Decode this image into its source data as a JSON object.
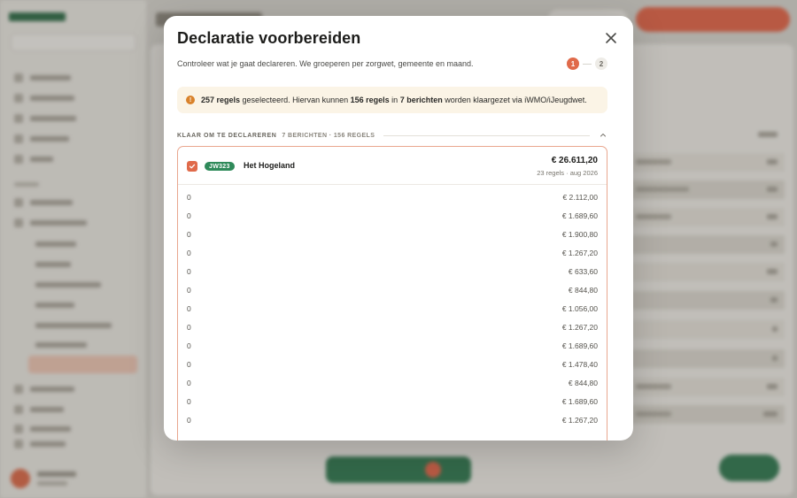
{
  "modal": {
    "title": "Declaratie voorbereiden",
    "subtitle": "Controleer wat je gaat declareren. We groeperen per zorgwet, gemeente en maand.",
    "steps": [
      "1",
      "2"
    ],
    "active_step": 1
  },
  "banner": {
    "count_selected": "257 regels",
    "text_selected": " geselecteerd. Hiervan kunnen ",
    "count_ready": "156 regels",
    "text_in": " in ",
    "count_messages": "7 berichten",
    "text_tail": " worden klaargezet via iWMO/iJeugdwet."
  },
  "section": {
    "title": "KLAAR OM TE DECLAREREN",
    "meta": "7 BERICHTEN · 156 REGELS"
  },
  "group": {
    "badge": "JW323",
    "name": "Het Hogeland",
    "total": "€ 26.611,20",
    "meta": "23 regels · aug 2026",
    "rows": [
      {
        "left": "0",
        "amount": "€ 2.112,00"
      },
      {
        "left": "0",
        "amount": "€ 1.689,60"
      },
      {
        "left": "0",
        "amount": "€ 1.900,80"
      },
      {
        "left": "0",
        "amount": "€ 1.267,20"
      },
      {
        "left": "0",
        "amount": "€ 633,60"
      },
      {
        "left": "0",
        "amount": "€ 844,80"
      },
      {
        "left": "0",
        "amount": "€ 1.056,00"
      },
      {
        "left": "0",
        "amount": "€ 1.267,20"
      },
      {
        "left": "0",
        "amount": "€ 1.689,60"
      },
      {
        "left": "0",
        "amount": "€ 1.478,40"
      },
      {
        "left": "0",
        "amount": "€ 844,80"
      },
      {
        "left": "0",
        "amount": "€ 1.689,60"
      },
      {
        "left": "0",
        "amount": "€ 1.267,20"
      }
    ]
  },
  "colors": {
    "accent": "#e06a4a",
    "brand_green": "#2f8a5a",
    "banner_bg": "#fbf4e6",
    "warning": "#d9822b"
  },
  "icons": {
    "close": "close-icon",
    "warning": "warning-icon",
    "collapse": "chevron-up-icon",
    "check": "check-icon"
  }
}
